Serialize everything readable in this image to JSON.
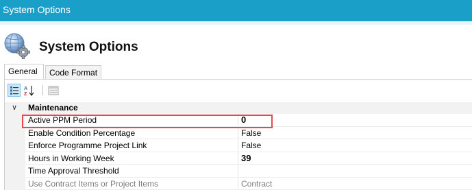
{
  "window": {
    "title": "System Options"
  },
  "header": {
    "title": "System Options",
    "icon": "globe-gear-icon"
  },
  "tabs": [
    {
      "label": "General",
      "selected": true
    },
    {
      "label": "Code Format",
      "selected": false
    }
  ],
  "toolbar": {
    "categorized": {
      "icon": "categorized-view-icon",
      "active": true
    },
    "alphabetical": {
      "icon": "sort-az-icon",
      "glyph": "A↓",
      "active": false
    },
    "property_pages": {
      "icon": "property-pages-icon",
      "enabled": false
    }
  },
  "property_grid": {
    "category": {
      "label": "Maintenance",
      "toggle": "∨"
    },
    "rows": [
      {
        "name": "Active PPM Period",
        "value": "0",
        "bold": true,
        "selected": true
      },
      {
        "name": "Enable Condition Percentage",
        "value": "False",
        "bold": false
      },
      {
        "name": "Enforce Programme Project Link",
        "value": "False",
        "bold": false
      },
      {
        "name": "Hours in Working Week",
        "value": "39",
        "bold": true
      },
      {
        "name": "Time Approval Threshold",
        "value": "",
        "bold": false
      },
      {
        "name": "Use Contract Items or Project Items",
        "value": "Contract",
        "bold": false,
        "disabled": true
      }
    ]
  },
  "colors": {
    "titlebar": "#1a9fc8",
    "highlight_border": "#e5484d",
    "category_background": "#f2f2f2"
  }
}
